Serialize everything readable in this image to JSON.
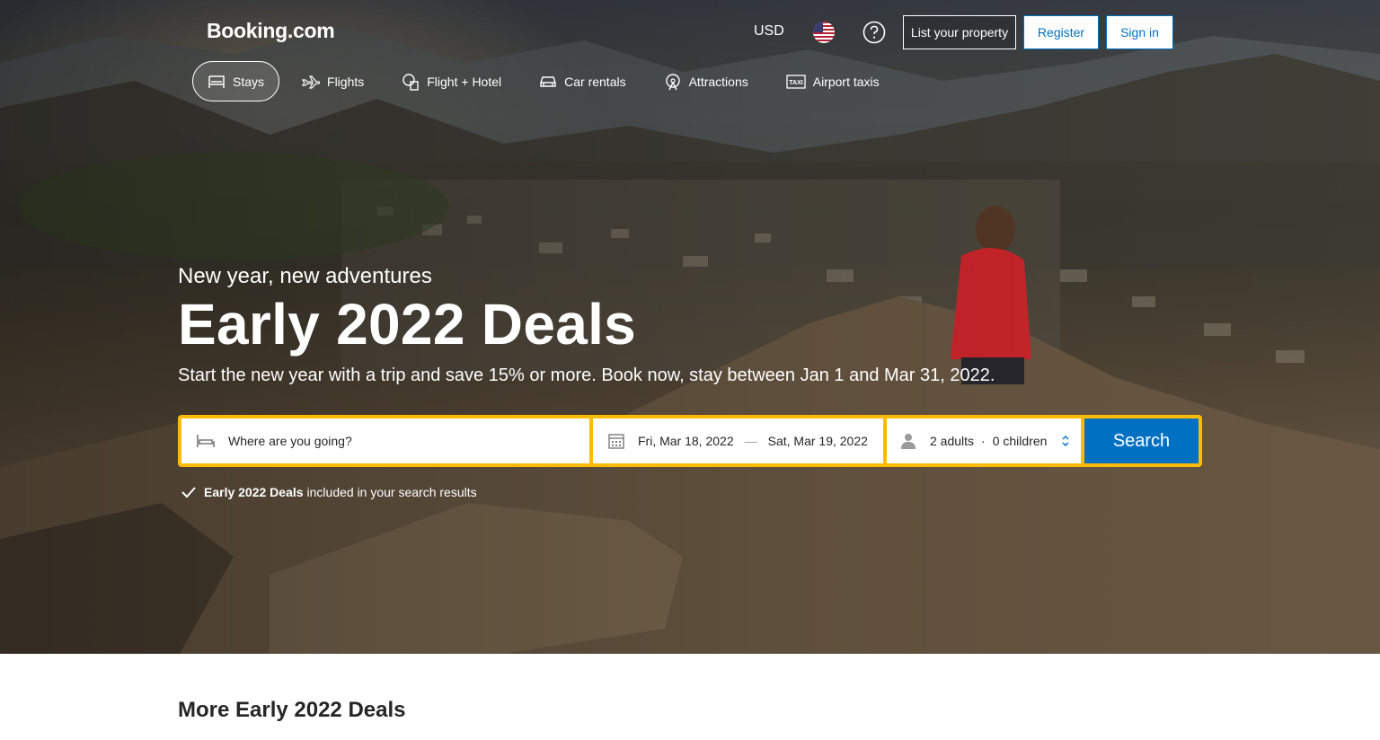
{
  "header": {
    "logo": "Booking.com",
    "currency": "USD",
    "list_property": "List your property",
    "register": "Register",
    "sign_in": "Sign in"
  },
  "nav": {
    "items": [
      {
        "label": "Stays",
        "icon": "bed-icon",
        "active": true
      },
      {
        "label": "Flights",
        "icon": "plane-icon"
      },
      {
        "label": "Flight + Hotel",
        "icon": "flight-hotel-icon"
      },
      {
        "label": "Car rentals",
        "icon": "car-icon"
      },
      {
        "label": "Attractions",
        "icon": "attractions-icon"
      },
      {
        "label": "Airport taxis",
        "icon": "taxi-icon"
      }
    ]
  },
  "hero": {
    "subhead": "New year, new adventures",
    "headline": "Early 2022 Deals",
    "tagline": "Start the new year with a trip and save 15% or more. Book now, stay between Jan 1 and Mar 31, 2022."
  },
  "search": {
    "destination_placeholder": "Where are you going?",
    "checkin": "Fri, Mar 18, 2022",
    "date_separator": "—",
    "checkout": "Sat, Mar 19, 2022",
    "adults": "2 adults",
    "guests_separator": "·",
    "children": "0 children",
    "button": "Search"
  },
  "deals_note": {
    "bold": "Early 2022 Deals",
    "rest": "included in your search results"
  },
  "section": {
    "title": "More Early 2022 Deals"
  },
  "colors": {
    "brand_blue": "#0071c2",
    "search_border": "#febb02",
    "text_dark": "#262626"
  }
}
